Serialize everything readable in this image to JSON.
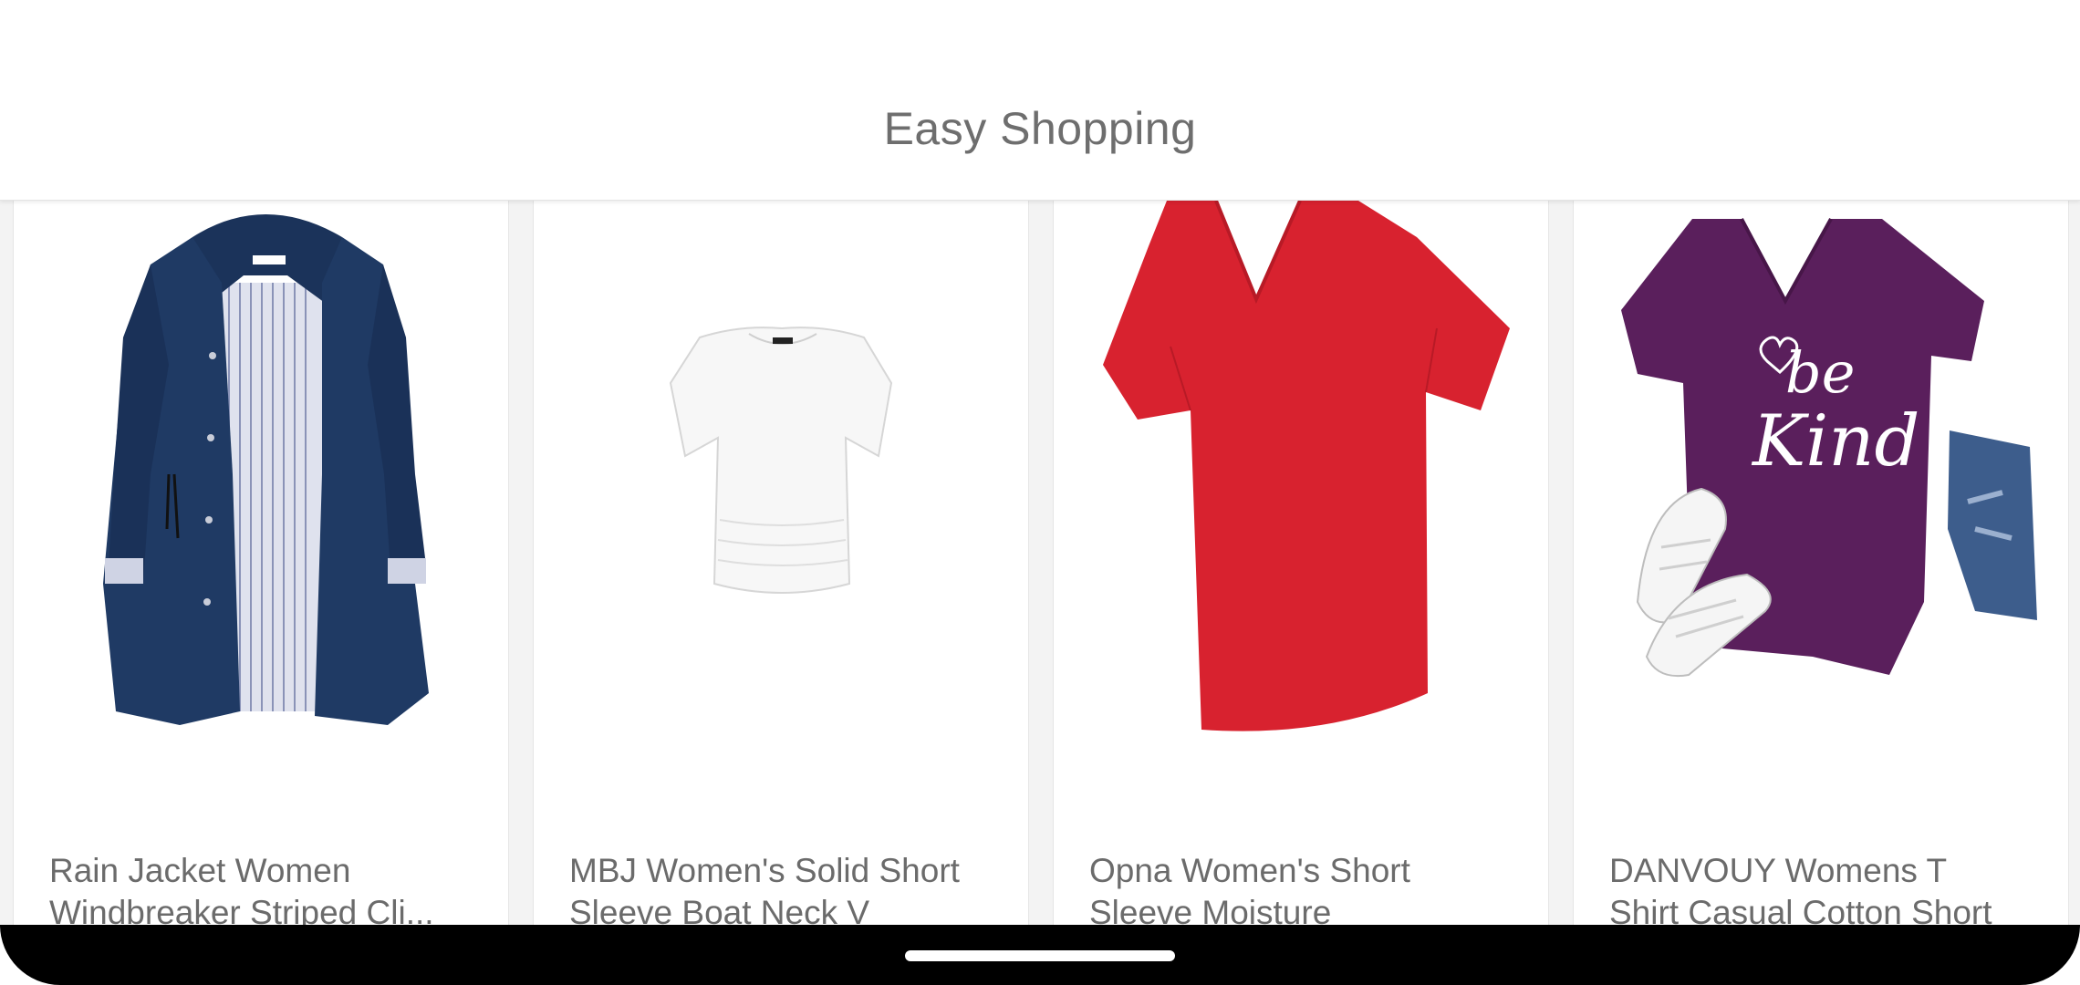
{
  "app_bar": {
    "title": "Easy Shopping"
  },
  "products": [
    {
      "title": "Rain Jacket Women\nWindbreaker Striped Cli...",
      "image": "navy-rain-jacket",
      "color": "#1f3a64"
    },
    {
      "title": "MBJ Women's Solid Short\nSleeve Boat Neck V",
      "image": "white-boat-neck-top",
      "color": "#f7f7f7"
    },
    {
      "title": "Opna Women's Short\nSleeve Moisture",
      "image": "red-v-neck-tshirt",
      "color": "#d8222f"
    },
    {
      "title": "DANVOUY Womens T\nShirt Casual Cotton Short",
      "image": "purple-be-kind-tshirt",
      "color": "#5a1f5c"
    }
  ],
  "product_4_print": {
    "line1": "be",
    "line2": "Kind"
  },
  "nav_bar": {
    "icon": "home-gesture-pill"
  }
}
